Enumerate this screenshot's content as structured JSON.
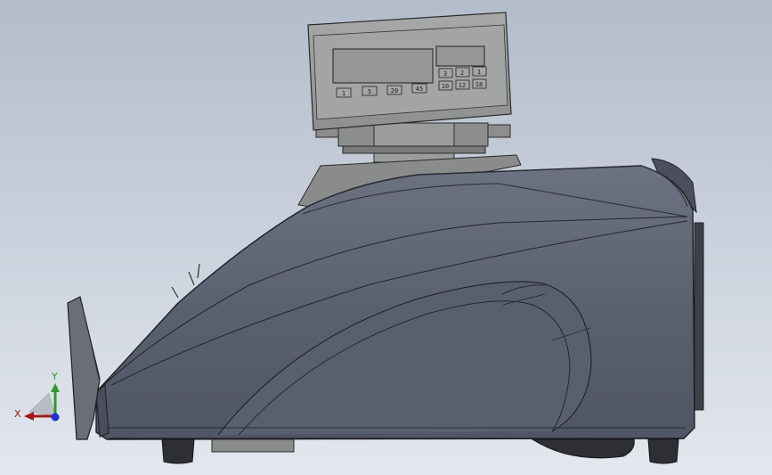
{
  "scene": {
    "background_top": "#b3bccb",
    "background_bottom": "#e3e7ee",
    "body_color": "#5a5f6e",
    "display_color": "#9a9c9c"
  },
  "display": {
    "left_keys": [
      "1",
      "5",
      "20",
      "45"
    ],
    "right_keys": [
      [
        "3",
        "2",
        "1"
      ],
      [
        "10",
        "12",
        "18"
      ]
    ]
  },
  "triad": {
    "x_label": "X",
    "y_label": "Y",
    "x_color": "#a11a1a",
    "y_color": "#2a9a2a",
    "z_color": "#1f2fd6"
  }
}
